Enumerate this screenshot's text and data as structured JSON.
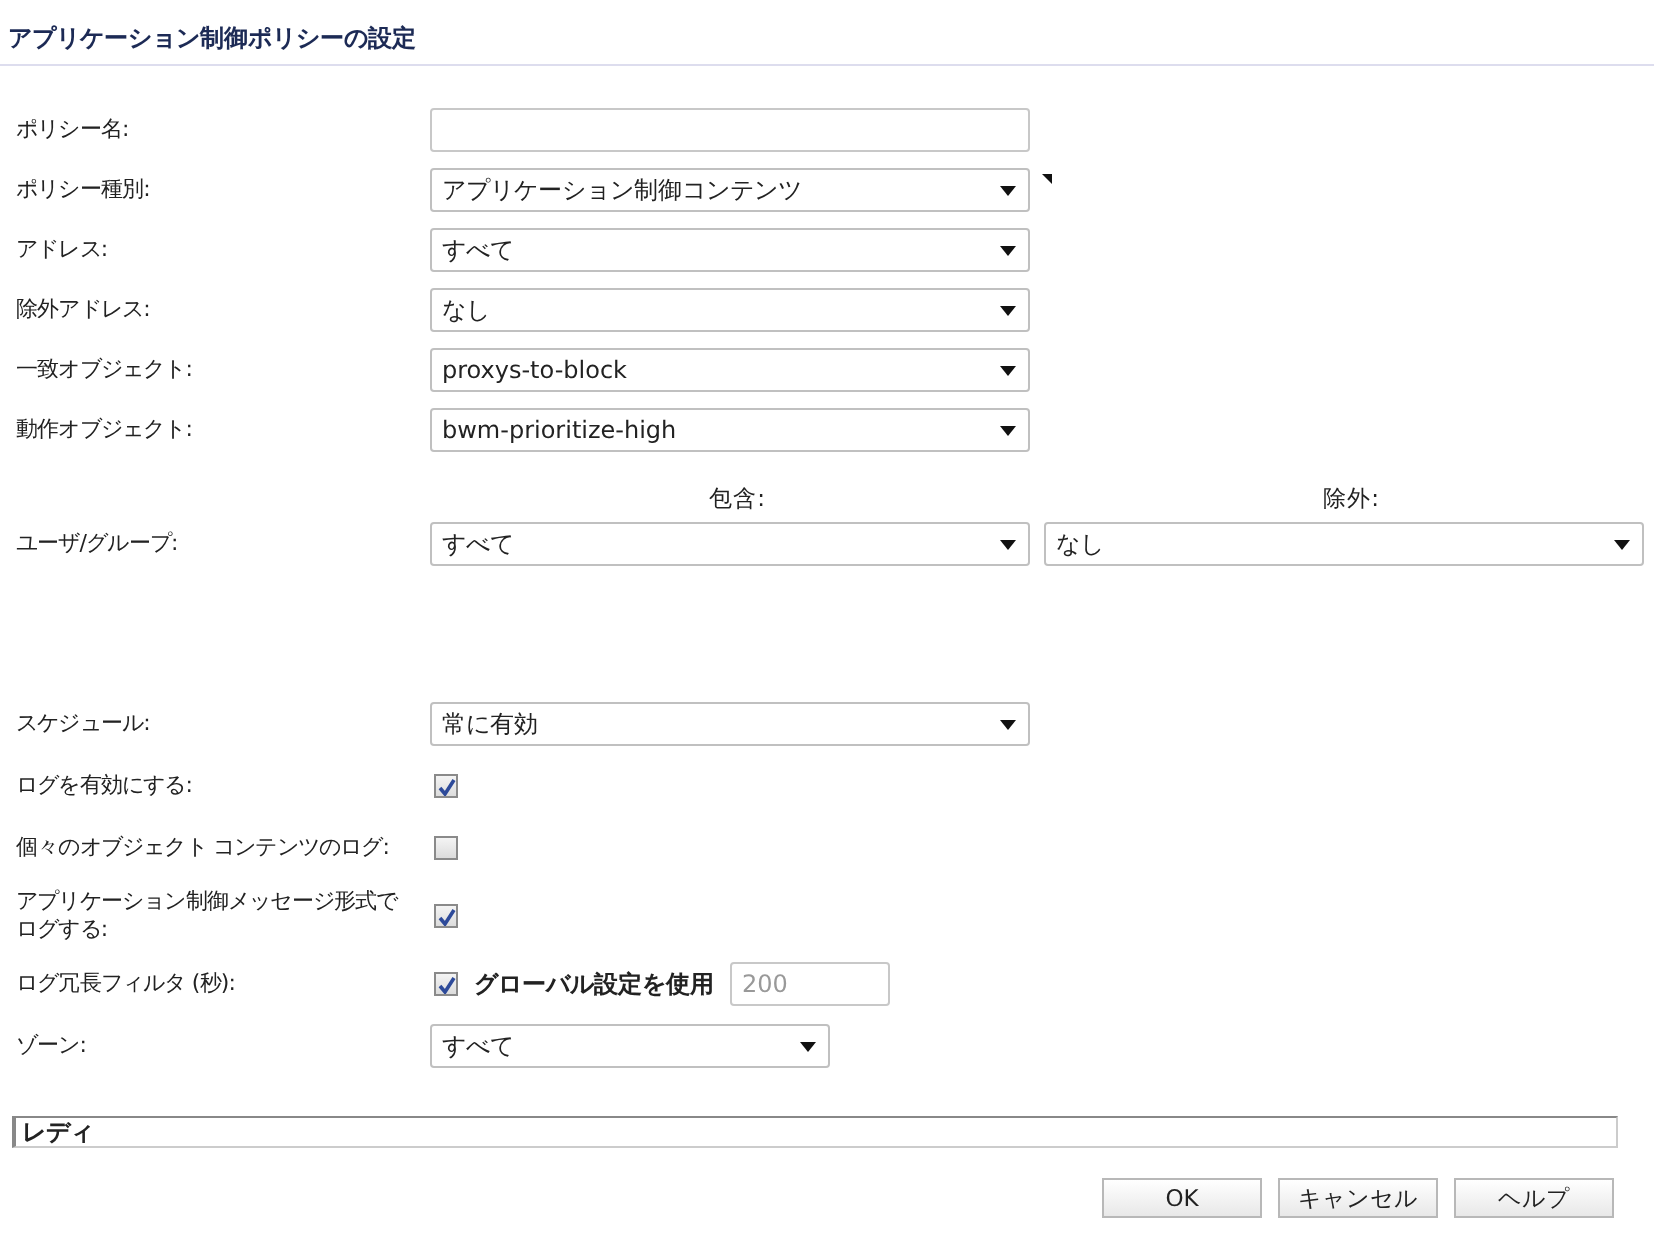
{
  "title": "アプリケーション制御ポリシーの設定",
  "fields": [
    {
      "kind": "text",
      "label": "ポリシー名:"
    },
    {
      "kind": "select",
      "label": "ポリシー種別:",
      "value": "アプリケーション制御コンテンツ",
      "marker": true
    },
    {
      "kind": "select",
      "label": "アドレス:",
      "value": "すべて"
    },
    {
      "kind": "select",
      "label": "除外アドレス:",
      "value": "なし"
    },
    {
      "kind": "select",
      "label": "一致オブジェクト:",
      "value": "proxys-to-block"
    },
    {
      "kind": "select",
      "label": "動作オブジェクト:",
      "value": "bwm-prioritize-high"
    }
  ],
  "user_group": {
    "label": "ユーザ/グループ:",
    "include_heading": "包含:",
    "exclude_heading": "除外:",
    "include": "すべて",
    "exclude": "なし"
  },
  "log_fields": [
    {
      "kind": "select",
      "label": "スケジュール:",
      "value": "常に有効"
    },
    {
      "kind": "checkbox",
      "label": "ログを有効にする:",
      "checked": true
    },
    {
      "kind": "checkbox",
      "label": "個々のオブジェクト コンテンツのログ:",
      "checked": false
    },
    {
      "kind": "checkbox",
      "label": "アプリケーション制御メッセージ形式でログする:",
      "checked": true
    },
    {
      "kind": "filter",
      "label": "ログ冗長フィルタ (秒):",
      "checked": true,
      "option": "グローバル設定を使用",
      "value": "200",
      "disabled": true
    },
    {
      "kind": "short_select",
      "label": "ゾーン:",
      "value": "すべて"
    }
  ],
  "status": "レディ",
  "buttons": [
    "OK",
    "キャンセル",
    "ヘルプ"
  ]
}
